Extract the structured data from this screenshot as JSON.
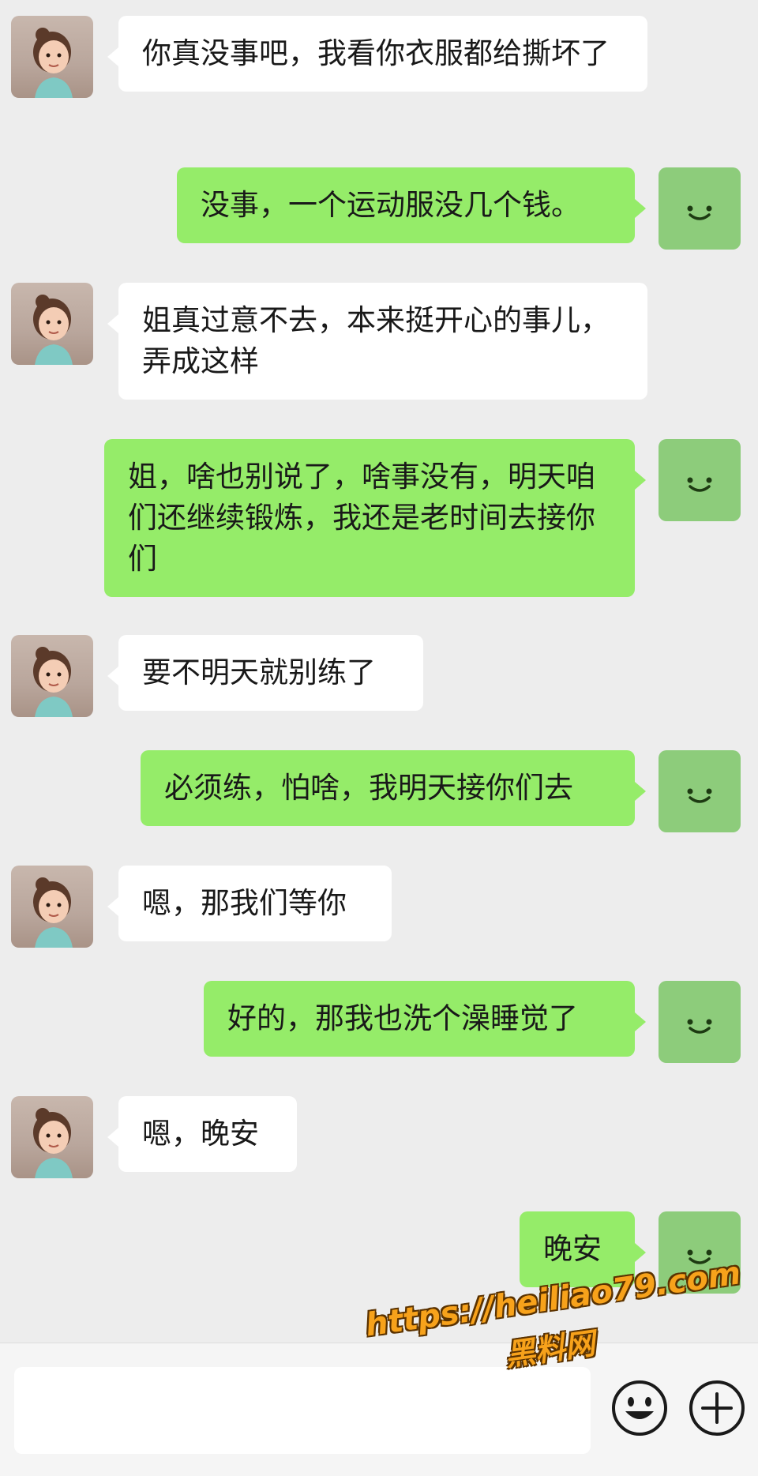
{
  "messages": [
    {
      "from": "other",
      "text": "你真没事吧，我看你衣服都给撕坏了"
    },
    {
      "from": "self",
      "text": "没事，一个运动服没几个钱。"
    },
    {
      "from": "other",
      "text": "姐真过意不去，本来挺开心的事儿，弄成这样"
    },
    {
      "from": "self",
      "text": "姐，啥也别说了，啥事没有，明天咱们还继续锻炼，我还是老时间去接你们"
    },
    {
      "from": "other",
      "text": "要不明天就别练了"
    },
    {
      "from": "self",
      "text": "必须练，怕啥，我明天接你们去"
    },
    {
      "from": "other",
      "text": "嗯，那我们等你"
    },
    {
      "from": "self",
      "text": "好的，那我也洗个澡睡觉了"
    },
    {
      "from": "other",
      "text": "嗯，晚安"
    },
    {
      "from": "self",
      "text": "晚安"
    }
  ],
  "watermark": {
    "url": "https://heiliao79.com",
    "name": "黑料网"
  },
  "icons": {
    "emoji": "emoji-icon",
    "plus": "plus-icon"
  },
  "colors": {
    "self_bubble": "#95ec69",
    "other_bubble": "#ffffff",
    "background": "#ededed",
    "watermark": "#f7a21b"
  }
}
